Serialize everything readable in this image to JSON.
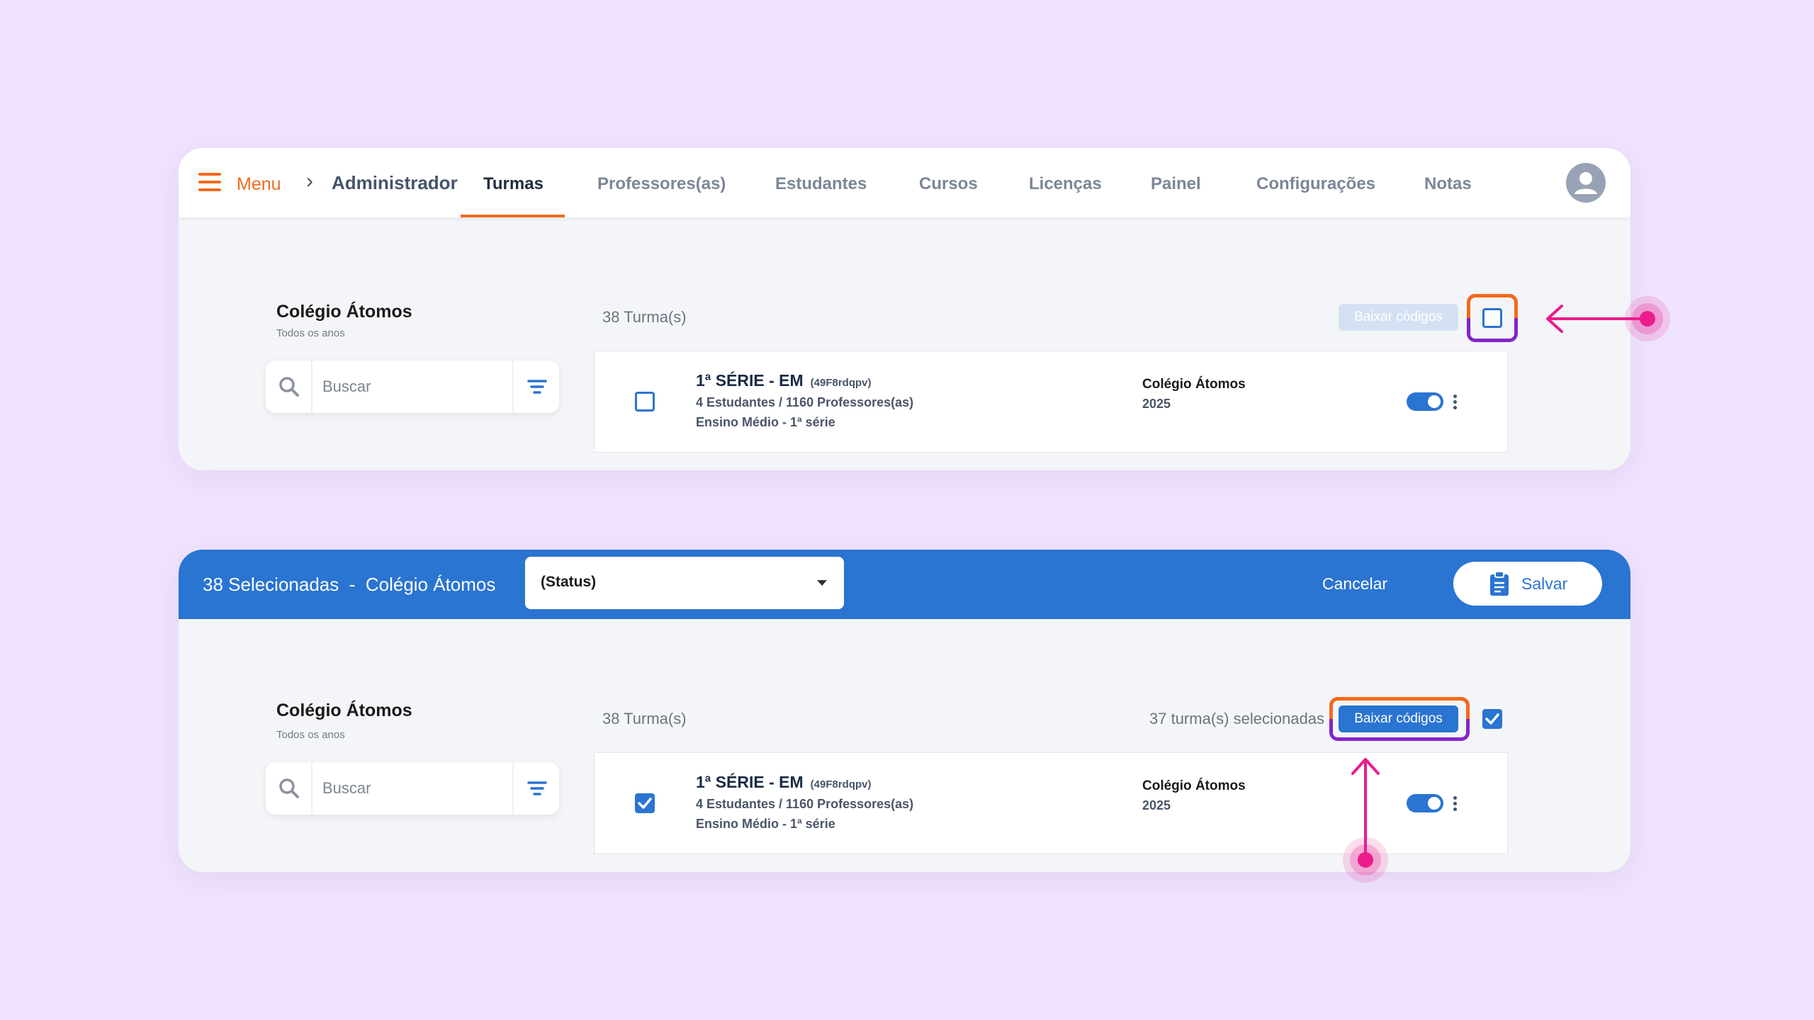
{
  "nav": {
    "menu_label": "Menu",
    "breadcrumb": "Administrador",
    "tabs": [
      {
        "label": "Turmas"
      },
      {
        "label": "Professores(as)"
      },
      {
        "label": "Estudantes"
      },
      {
        "label": "Cursos"
      },
      {
        "label": "Licenças"
      },
      {
        "label": "Painel"
      },
      {
        "label": "Configurações"
      },
      {
        "label": "Notas"
      }
    ]
  },
  "school": {
    "name": "Colégio Átomos",
    "subtitle": "Todos os anos"
  },
  "search": {
    "placeholder": "Buscar"
  },
  "list": {
    "count_label": "38 Turma(s)",
    "download_label": "Baixar códigos",
    "selected_label": "37 turma(s) selecionadas"
  },
  "row": {
    "title": "1ª SÉRIE - EM",
    "code": "(49F8rdqpv)",
    "stats": "4 Estudantes / 1160 Professores(as)",
    "level": "Ensino Médio - 1ª série",
    "school": "Colégio Átomos",
    "year": "2025"
  },
  "selection_bar": {
    "count_text": "38 Selecionadas",
    "separator": "-",
    "school_text": "Colégio Átomos",
    "status_value": "(Status)",
    "cancel_label": "Cancelar",
    "save_label": "Salvar"
  },
  "colors": {
    "accent": "#f06a1d",
    "primary": "#2a74d2",
    "annotation": "#ec1c8c",
    "background": "#f0e3fd"
  }
}
